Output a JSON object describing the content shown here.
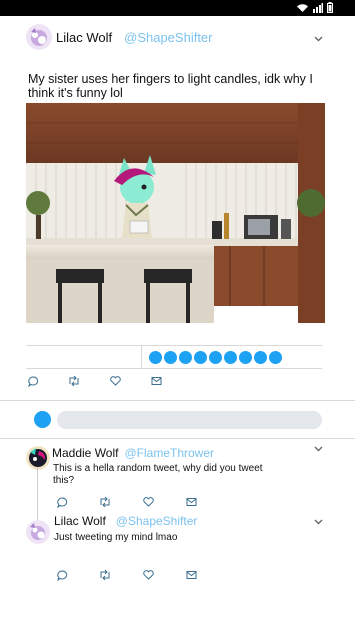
{
  "status_bar": {
    "icons": [
      "wifi-icon",
      "signal-icon",
      "battery-icon"
    ]
  },
  "tweet": {
    "author_name": "Lilac Wolf",
    "author_handle": "@ShapeShifter",
    "text": "My sister uses her fingers to light candles, idk why I think it's funny lol",
    "image_description_icon": "kitchen-photo",
    "poll": {
      "filled_dots": 9
    },
    "actions": [
      "reply-icon",
      "retweet-icon",
      "like-icon",
      "share-icon"
    ]
  },
  "compose": {
    "placeholder": ""
  },
  "replies": [
    {
      "author_name": "Maddie Wolf",
      "author_handle": "@FlameThrower",
      "text": "This is a hella random tweet, why did you tweet this?"
    },
    {
      "author_name": "Lilac Wolf",
      "author_handle": "@ShapeShifter",
      "text": "Just tweeting my mind lmao"
    }
  ],
  "colors": {
    "accent": "#1da1f2",
    "handle": "#7cc2ef",
    "separator": "#d9d9d9"
  }
}
